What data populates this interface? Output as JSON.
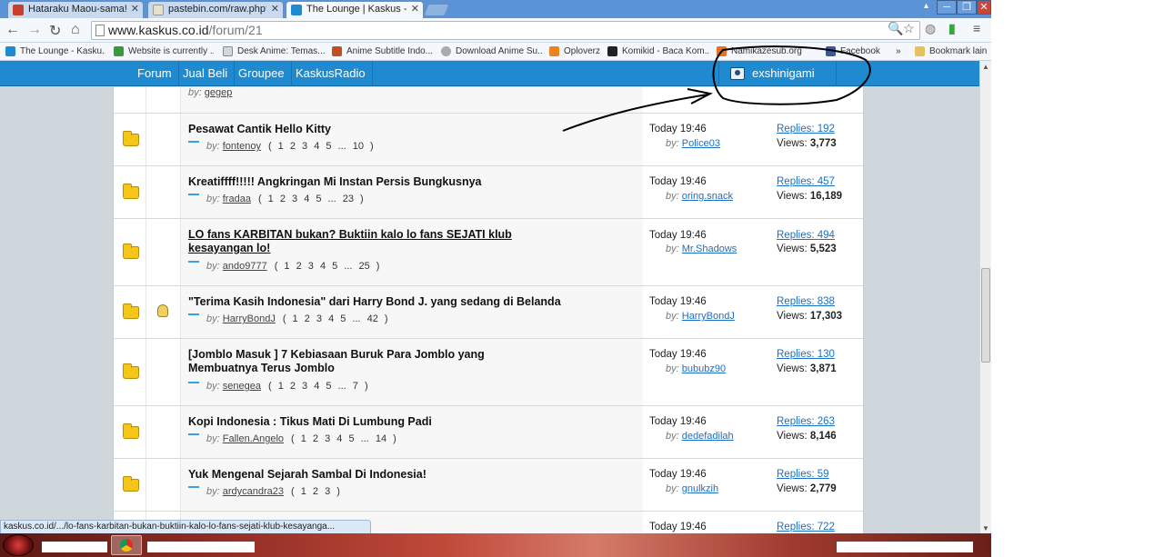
{
  "browser": {
    "tabs": [
      {
        "title": "Hataraku Maou-sama! Ep"
      },
      {
        "title": "pastebin.com/raw.php?i"
      },
      {
        "title": "The Lounge | Kaskus - The"
      }
    ],
    "url_host": "www.kaskus.co.id",
    "url_path": "/forum/21",
    "bookmarks": [
      "The Lounge - Kasku...",
      "Website is currently ...",
      "Desk Anime: Temas...",
      "Anime Subtitle Indo...",
      "Download Anime Su...",
      "Oploverz",
      "Komikid - Baca Kom...",
      "Namikazesub.org |...",
      "Facebook",
      "Bookmark lain"
    ],
    "bookmark_more": "»",
    "status_url": "kaskus.co.id/.../lo-fans-karbitan-bukan-buktiin-kalo-lo-fans-sejati-klub-kesayanga..."
  },
  "kaskus_nav": {
    "items": [
      "Forum",
      "Jual Beli",
      "Groupee",
      "KaskusRadio"
    ],
    "username": "exshinigami"
  },
  "labels": {
    "by": "by:",
    "replies_prefix": "Replies:",
    "views_prefix": "Views:"
  },
  "prev_thread_author": "gegep",
  "threads": [
    {
      "title": "Pesawat Cantik Hello Kitty",
      "author": "fontenoy",
      "pages": "( 1 2 3 4 5 ... 10 )",
      "last_time": "Today 19:46",
      "last_by": "Police03",
      "replies": "192",
      "views": "3,773"
    },
    {
      "title": "Kreatiffff!!!!! Angkringan Mi Instan Persis Bungkusnya",
      "author": "fradaa",
      "pages": "( 1 2 3 4 5 ... 23 )",
      "last_time": "Today 19:46",
      "last_by": "oring.snack",
      "replies": "457",
      "views": "16,189"
    },
    {
      "title": "LO fans KARBITAN bukan? Buktiin kalo lo fans SEJATI klub kesayangan lo!",
      "author": "ando9777",
      "pages": "( 1 2 3 4 5 ... 25 )",
      "last_time": "Today 19:46",
      "last_by": "Mr.Shadows",
      "replies": "494",
      "views": "5,523"
    },
    {
      "title": "\"Terima Kasih Indonesia\" dari Harry Bond J. yang sedang di Belanda",
      "author": "HarryBondJ",
      "pages": "( 1 2 3 4 5 ... 42 )",
      "last_time": "Today 19:46",
      "last_by": "HarryBondJ",
      "replies": "838",
      "views": "17,303"
    },
    {
      "title": "[Jomblo Masuk ] 7 Kebiasaan Buruk Para Jomblo yang Membuatnya Terus Jomblo",
      "author": "senegea",
      "pages": "( 1 2 3 4 5 ... 7 )",
      "last_time": "Today 19:46",
      "last_by": "bububz90",
      "replies": "130",
      "views": "3,871"
    },
    {
      "title": "Kopi Indonesia : Tikus Mati Di Lumbung Padi",
      "author": "Fallen.Angelo",
      "pages": "( 1 2 3 4 5 ... 14 )",
      "last_time": "Today 19:46",
      "last_by": "dedefadilah",
      "replies": "263",
      "views": "8,146"
    },
    {
      "title": "Yuk Mengenal Sejarah Sambal Di Indonesia!",
      "author": "ardycandra23",
      "pages": "( 1 2 3 )",
      "last_time": "Today 19:46",
      "last_by": "gnulkzih",
      "replies": "59",
      "views": "2,779"
    },
    {
      "title": "",
      "author": "",
      "pages": "",
      "last_time": "Today 19:46",
      "last_by": "",
      "replies": "722",
      "views": ""
    }
  ],
  "colors": {
    "kaskus_blue": "#1f8ad0",
    "link_blue": "#1c6fc2",
    "folder_yellow": "#f5c518",
    "chrome_frame": "#5a93d6"
  },
  "icons": [
    "back-icon",
    "forward-icon",
    "reload-icon",
    "home-icon",
    "search-icon",
    "star-icon",
    "menu-icon",
    "folder-icon",
    "avatar-icon"
  ]
}
